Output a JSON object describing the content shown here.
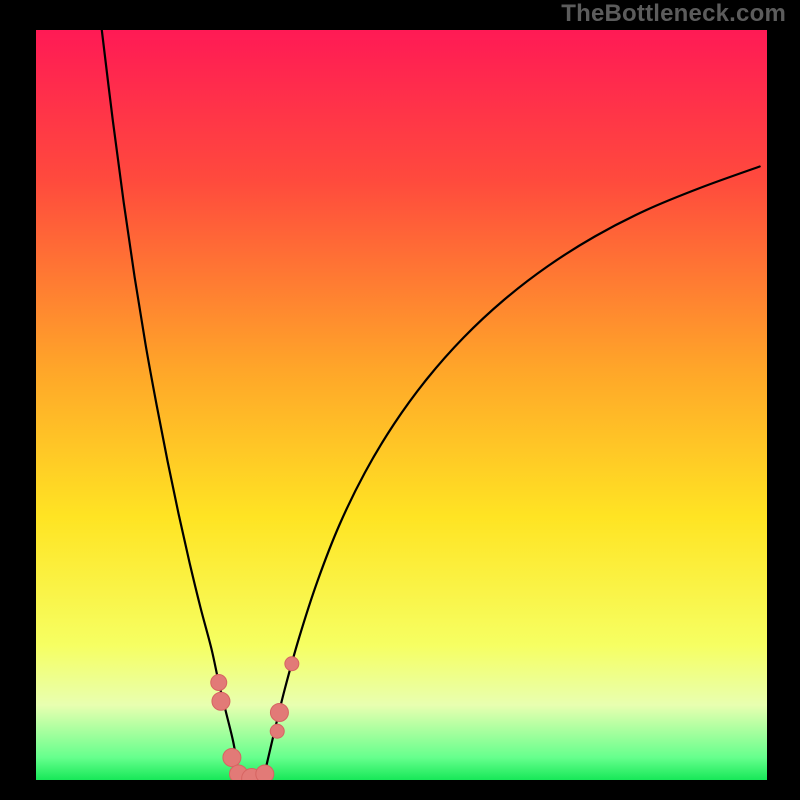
{
  "chart_data": {
    "type": "line",
    "title": "",
    "xlabel": "",
    "ylabel": "",
    "xlim": [
      0,
      100
    ],
    "ylim": [
      0,
      100
    ],
    "watermark": "TheBottleneck.com",
    "background_gradient": {
      "stops": [
        {
          "offset": 0.0,
          "color": "#ff1a55"
        },
        {
          "offset": 0.2,
          "color": "#ff4a3d"
        },
        {
          "offset": 0.45,
          "color": "#ffa529"
        },
        {
          "offset": 0.65,
          "color": "#ffe423"
        },
        {
          "offset": 0.82,
          "color": "#f6ff62"
        },
        {
          "offset": 0.9,
          "color": "#e8ffb0"
        },
        {
          "offset": 0.97,
          "color": "#66ff8d"
        },
        {
          "offset": 1.0,
          "color": "#17e858"
        }
      ]
    },
    "frame": {
      "outer_w": 800,
      "outer_h": 800,
      "inner_x": 36,
      "inner_y": 30,
      "inner_w": 731,
      "inner_h": 750
    },
    "series": [
      {
        "name": "left-curve",
        "color": "#000000",
        "width": 2.2,
        "x": [
          9.0,
          10.5,
          12.0,
          13.5,
          15.0,
          16.5,
          18.0,
          19.5,
          21.0,
          22.5,
          24.0,
          25.0,
          26.0,
          27.0,
          27.7
        ],
        "y": [
          100.0,
          88.0,
          77.0,
          67.0,
          58.0,
          50.0,
          42.5,
          35.5,
          29.0,
          23.0,
          17.5,
          13.0,
          9.0,
          5.0,
          1.0
        ]
      },
      {
        "name": "right-curve",
        "color": "#000000",
        "width": 2.2,
        "x": [
          31.3,
          32.5,
          34.0,
          36.0,
          38.5,
          41.5,
          45.0,
          49.0,
          53.5,
          58.5,
          64.0,
          70.0,
          76.5,
          83.5,
          91.0,
          99.0
        ],
        "y": [
          1.0,
          6.0,
          12.0,
          19.0,
          26.5,
          34.0,
          41.0,
          47.5,
          53.5,
          59.0,
          64.0,
          68.5,
          72.5,
          76.0,
          79.0,
          81.8
        ]
      },
      {
        "name": "valley-floor",
        "color": "#000000",
        "width": 2.2,
        "x": [
          27.7,
          28.5,
          29.5,
          30.5,
          31.3
        ],
        "y": [
          1.0,
          0.3,
          0.0,
          0.3,
          1.0
        ]
      }
    ],
    "markers": {
      "color": "#e27a77",
      "stroke": "#d66461",
      "points": [
        {
          "x": 25.0,
          "y": 13.0,
          "r": 8
        },
        {
          "x": 25.3,
          "y": 10.5,
          "r": 9
        },
        {
          "x": 26.8,
          "y": 3.0,
          "r": 9
        },
        {
          "x": 27.7,
          "y": 0.8,
          "r": 9
        },
        {
          "x": 29.5,
          "y": 0.2,
          "r": 10
        },
        {
          "x": 31.3,
          "y": 0.8,
          "r": 9
        },
        {
          "x": 33.0,
          "y": 6.5,
          "r": 7
        },
        {
          "x": 33.3,
          "y": 9.0,
          "r": 9
        },
        {
          "x": 35.0,
          "y": 15.5,
          "r": 7
        }
      ]
    }
  }
}
